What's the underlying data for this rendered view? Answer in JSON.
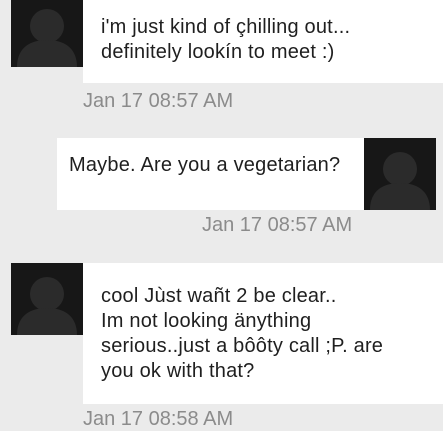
{
  "conversation": {
    "messages": [
      {
        "sender": "other",
        "avatar_icon": "default-user-avatar-icon",
        "lines": [
          "i'm just kind of çhilling out...",
          "definitely lookín to meet :)"
        ],
        "timestamp": "Jan 17 08:57 AM"
      },
      {
        "sender": "self",
        "avatar_icon": "default-user-avatar-icon",
        "lines": [
          "Maybe. Are you a vegetarian?"
        ],
        "timestamp": "Jan 17 08:57 AM"
      },
      {
        "sender": "other",
        "avatar_icon": "default-user-avatar-icon",
        "lines": [
          "cool Jùst wañt 2 be clear..",
          "Im not looking änything",
          "serious..just a bôôty call ;P. are",
          "you ok with that?"
        ],
        "timestamp": "Jan 17 08:58 AM"
      }
    ]
  },
  "colors": {
    "background": "#ebebeb",
    "bubble": "#ffffff",
    "avatar_bg": "#171717",
    "avatar_silhouette": "#2b2b2b",
    "timestamp_text": "#8b8b8b"
  }
}
